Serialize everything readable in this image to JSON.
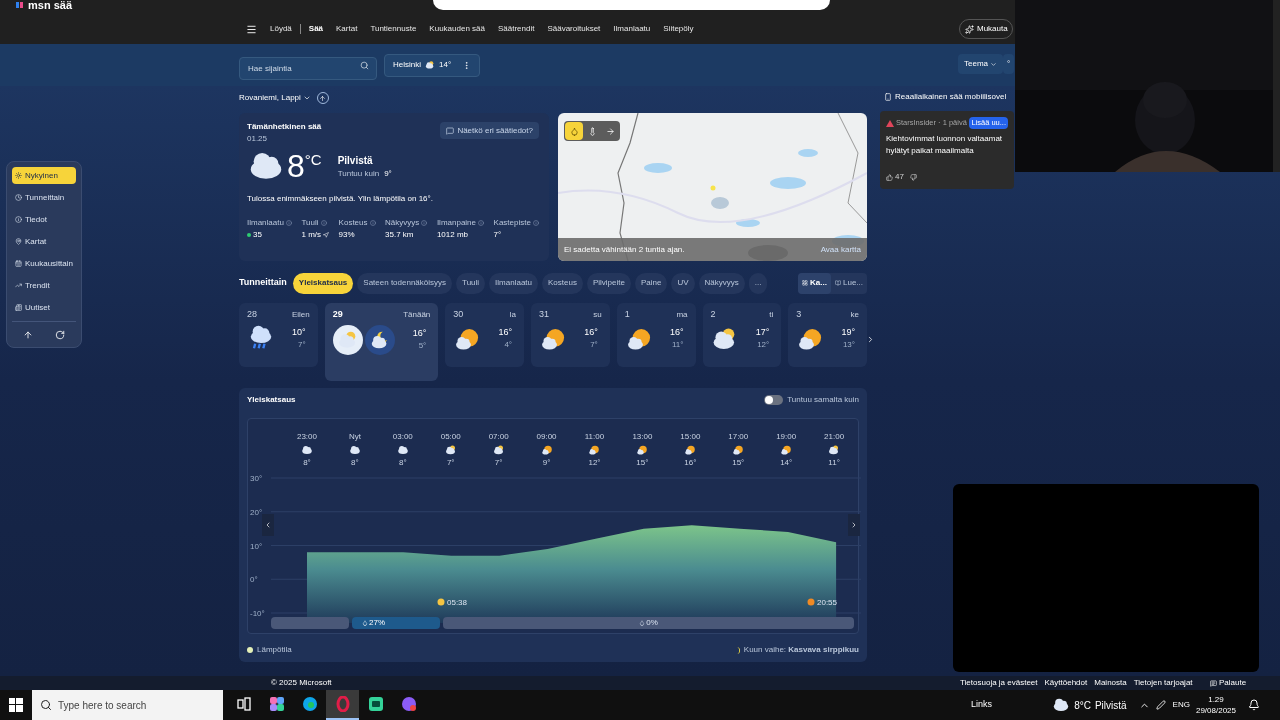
{
  "header": {
    "logo": "msn sää",
    "nav": [
      {
        "label": "Löydä",
        "selected": false
      },
      {
        "label": "Sää",
        "selected": true
      },
      {
        "label": "Kartat",
        "selected": false
      },
      {
        "label": "Tuntiennuste",
        "selected": false
      },
      {
        "label": "Kuukauden sää",
        "selected": false
      },
      {
        "label": "Säätrendit",
        "selected": false
      },
      {
        "label": "Säävaroitukset",
        "selected": false
      },
      {
        "label": "Ilmanlaatu",
        "selected": false
      },
      {
        "label": "Siitepöly",
        "selected": false
      }
    ],
    "customize_button": "Mukauta"
  },
  "toolbar": {
    "search": {
      "placeholder": "Hae sijaintia"
    },
    "location_pill": {
      "city": "Helsinki",
      "temp": "14°"
    },
    "theme_button": "Teema",
    "unit_button": "°"
  },
  "location": "Rovaniemi, Lappi",
  "sidebar": {
    "items": [
      {
        "label": "Nykyinen",
        "selected": true
      },
      {
        "label": "Tunneittain",
        "selected": false
      },
      {
        "label": "Tiedot",
        "selected": false
      },
      {
        "label": "Kartat",
        "selected": false
      },
      {
        "label": "Kuukausittain",
        "selected": false
      },
      {
        "label": "Trendit",
        "selected": false
      },
      {
        "label": "Uutiset",
        "selected": false
      }
    ]
  },
  "current": {
    "title": "Tämänhetkinen sää",
    "time": "01.25",
    "temp": "8",
    "unit": "°C",
    "condition": "Pilvistä",
    "feels_label": "Tuntuu kuin",
    "feels_value": "9°",
    "feedback_button": "Näetkö eri säätiedot?",
    "summary": "Tulossa enimmäkseen pilvistä. Ylin lämpötila on 16°.",
    "details": [
      {
        "label": "Ilmanlaatu",
        "value": "35",
        "color": "#2ecc71"
      },
      {
        "label": "Tuuli",
        "value": "1 m/s"
      },
      {
        "label": "Kosteus",
        "value": "93%"
      },
      {
        "label": "Näkyvyys",
        "value": "35.7 km"
      },
      {
        "label": "Ilmanpaine",
        "value": "1012 mb"
      },
      {
        "label": "Kastepiste",
        "value": "7°"
      }
    ]
  },
  "map": {
    "layers": [
      {
        "selected": true
      },
      {
        "selected": false
      },
      {
        "selected": false
      }
    ],
    "status": "Ei sadetta vähintään 2 tuntia ajan.",
    "link": "Avaa kartta"
  },
  "tabs": {
    "heading": "Tunneittain",
    "items": [
      {
        "label": "Yleiskatsaus",
        "selected": true
      },
      {
        "label": "Sateen todennäköisyys",
        "selected": false
      },
      {
        "label": "Tuuli",
        "selected": false
      },
      {
        "label": "Ilmanlaatu",
        "selected": false
      },
      {
        "label": "Kosteus",
        "selected": false
      },
      {
        "label": "Pilvipeite",
        "selected": false
      },
      {
        "label": "Paine",
        "selected": false
      },
      {
        "label": "UV",
        "selected": false
      },
      {
        "label": "Näkyvyys",
        "selected": false
      },
      {
        "label": "...",
        "selected": false
      }
    ],
    "actions": [
      "Ka...",
      "Lue..."
    ]
  },
  "days": [
    {
      "date": "28",
      "day": "Eilen",
      "high": "10°",
      "low": "7°",
      "selected": false,
      "icons": [
        {
          "kind": "rain"
        }
      ]
    },
    {
      "date": "29",
      "day": "Tänään",
      "high": "16°",
      "low": "5°",
      "selected": true,
      "icons": [
        {
          "kind": "cloud-sun"
        },
        {
          "kind": "moon-cloud"
        }
      ]
    },
    {
      "date": "30",
      "day": "la",
      "high": "16°",
      "low": "4°",
      "selected": false,
      "icons": [
        {
          "kind": "sun-cloud"
        }
      ]
    },
    {
      "date": "31",
      "day": "su",
      "high": "16°",
      "low": "7°",
      "selected": false,
      "icons": [
        {
          "kind": "sun-cloud"
        }
      ]
    },
    {
      "date": "1",
      "day": "ma",
      "high": "16°",
      "low": "11°",
      "selected": false,
      "icons": [
        {
          "kind": "sun-cloud"
        }
      ]
    },
    {
      "date": "2",
      "day": "ti",
      "high": "17°",
      "low": "12°",
      "selected": false,
      "icons": [
        {
          "kind": "cloud-sun"
        }
      ]
    },
    {
      "date": "3",
      "day": "ke",
      "high": "19°",
      "low": "13°",
      "selected": false,
      "icons": [
        {
          "kind": "sun-cloud"
        }
      ]
    }
  ],
  "overview": {
    "title": "Yleiskatsaus",
    "toggle": {
      "label": "Tuntuu samalta kuin",
      "on": false
    },
    "hours": [
      {
        "time": "23:00",
        "kind": "cloud",
        "temp": "8°"
      },
      {
        "time": "Nyt",
        "kind": "cloud",
        "temp": "8°"
      },
      {
        "time": "03:00",
        "kind": "cloud",
        "temp": "8°"
      },
      {
        "time": "05:00",
        "kind": "cloud-sun",
        "temp": "7°"
      },
      {
        "time": "07:00",
        "kind": "cloud-sun",
        "temp": "7°"
      },
      {
        "time": "09:00",
        "kind": "sun-cloud",
        "temp": "9°"
      },
      {
        "time": "11:00",
        "kind": "sun-cloud",
        "temp": "12°"
      },
      {
        "time": "13:00",
        "kind": "sun-cloud",
        "temp": "15°"
      },
      {
        "time": "15:00",
        "kind": "sun-cloud",
        "temp": "16°"
      },
      {
        "time": "17:00",
        "kind": "sun-cloud",
        "temp": "15°"
      },
      {
        "time": "19:00",
        "kind": "sun-cloud",
        "temp": "14°"
      },
      {
        "time": "21:00",
        "kind": "cloud-sun",
        "temp": "11°"
      }
    ],
    "chart_data": {
      "type": "area",
      "values": [
        8,
        8,
        8,
        7,
        7,
        9,
        12,
        15,
        16,
        15,
        14,
        11
      ],
      "ylim": [
        -10,
        30
      ],
      "grid": true,
      "yticks": [
        {
          "value": 30,
          "label": "30°"
        },
        {
          "value": 20,
          "label": "20°"
        },
        {
          "value": 10,
          "label": "10°"
        },
        {
          "value": 0,
          "label": "0°"
        },
        {
          "value": -10,
          "label": "-10°"
        }
      ]
    },
    "sun_events": [
      {
        "kind": "sunrise",
        "time": "05:38"
      },
      {
        "kind": "sunset",
        "time": "20:55"
      }
    ],
    "precipitation": [
      {
        "kind": "past"
      },
      {
        "kind": "chance",
        "text": "27%",
        "highlighted": true
      },
      {
        "kind": "chance",
        "text": "0%",
        "highlighted": false
      }
    ],
    "legend": "Lämpötila",
    "moon": "Kuun vaihe: **Kasvava sirppikuu**"
  },
  "side": {
    "promo": "Reaaliaikainen sää mobiilisovel",
    "news": {
      "source": "StarsInsider · 1 päivä",
      "button": "Lisää uu...",
      "title": "Kiehtovimmat luonnon valtaamat hylätyt paikat maailmalta",
      "likes": "47"
    }
  },
  "footer": {
    "copyright": "© 2025 Microsoft",
    "links": [
      "Tietosuoja ja evästeet",
      "Käyttöehdot",
      "Mainosta",
      "Tietojen tarjoajat"
    ],
    "feedback": "Palaute"
  },
  "taskbar": {
    "search_placeholder": "Type here to search",
    "apps": [
      {
        "selected": false
      },
      {
        "selected": false
      },
      {
        "selected": false
      },
      {
        "selected": true
      },
      {
        "selected": false
      },
      {
        "selected": false
      }
    ],
    "links": "Links",
    "weather": "8°C",
    "weather_condition": "Pilvistä",
    "lang": "ENG",
    "time": "1.29",
    "date": "29/08/2025"
  }
}
